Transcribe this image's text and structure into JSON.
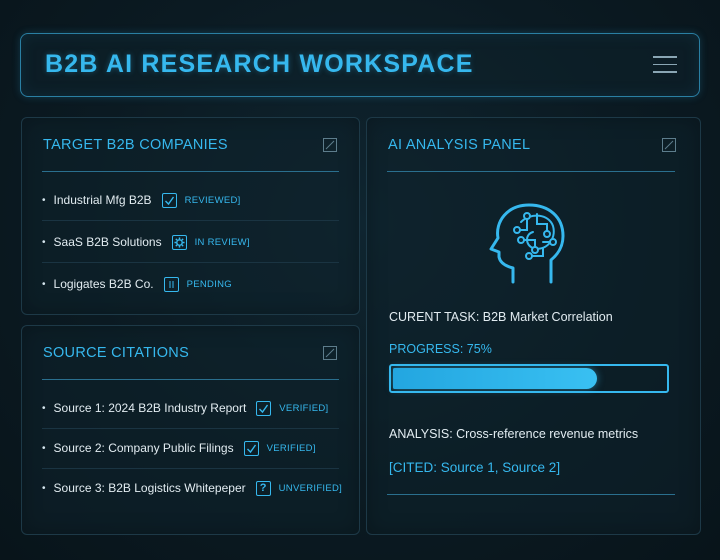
{
  "header": {
    "title": "B2B AI RESEARCH WORKSPACE",
    "menu_icon": "menu-icon"
  },
  "companies": {
    "title": "TARGET B2B COMPANIES",
    "items": [
      {
        "label": "Industrial Mfg B2B",
        "status": "REVIEWED]",
        "icon": "check-icon"
      },
      {
        "label": "SaaS B2B Solutions",
        "status": "IN REVIEW]",
        "icon": "gear-icon"
      },
      {
        "label": "Logigates B2B Co.",
        "status": "PENDING",
        "icon": "pause-icon"
      }
    ]
  },
  "citations": {
    "title": "SOURCE CITATIONS",
    "items": [
      {
        "label": "Source 1: 2024 B2B Industry Report",
        "status": "VERIFIED]",
        "icon": "check-icon"
      },
      {
        "label": "Source 2: Company Public Filings",
        "status": "VERIFIED]",
        "icon": "check-icon"
      },
      {
        "label": "Source 3: B2B Logistics Whitepeper",
        "status": "UNVERIFIED]",
        "icon": "question-icon"
      }
    ]
  },
  "ai": {
    "title": "AI ANALYSIS PANEL",
    "task": "CURENT TASK: B2B Market Correlation",
    "progress_label": "PROGRESS: 75%",
    "progress": 0.75,
    "analysis": "ANALYSIS: Cross-reference revenue metrics",
    "cited": "[CITED: Source 1, Source 2]"
  },
  "colors": {
    "accent": "#36b8ee",
    "background": "#0b1a22",
    "panel_border": "#1d3947"
  }
}
